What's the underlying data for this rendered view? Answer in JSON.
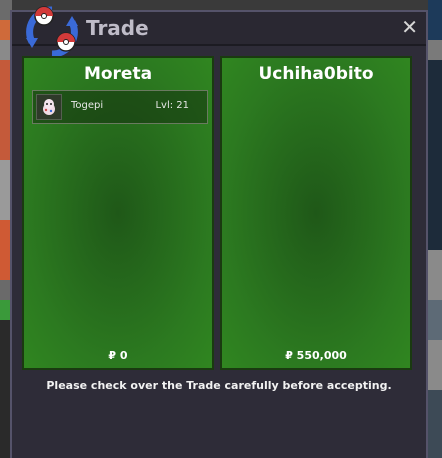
{
  "window": {
    "title": "Trade",
    "close_glyph": "✕",
    "logo_icon": "pokeball-swap-icon"
  },
  "trade": {
    "left": {
      "name": "Moreta",
      "items": [
        {
          "icon": "togepi-icon",
          "name": "Togepi",
          "level": "Lvl: 21"
        }
      ],
      "money": "₽ 0"
    },
    "right": {
      "name": "Uchiha0bito",
      "items": [],
      "money": "₽ 550,000"
    }
  },
  "notice": "Please check over the Trade carefully before accepting.",
  "colors": {
    "panel_green": "#2c7a20",
    "window_bg": "#2e2c38"
  }
}
